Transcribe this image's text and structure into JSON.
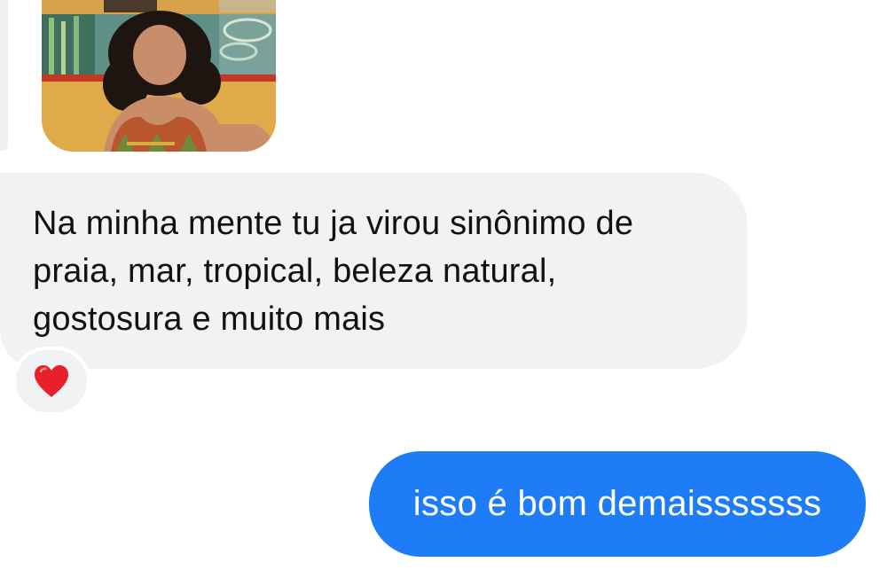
{
  "messages": {
    "incoming_photo": {
      "kind": "photo"
    },
    "incoming_text": "Na minha mente tu ja virou sinônimo de praia, mar, tropical, beleza natural, gostosura e muito mais",
    "reaction": {
      "emoji": "❤️",
      "icon": "heart-icon"
    },
    "outgoing_text": "isso é bom demaisssssss"
  },
  "colors": {
    "incoming_bubble": "#f1f2f4",
    "outgoing_bubble": "#1e7cf6",
    "incoming_text": "#111111",
    "outgoing_text": "#ffffff",
    "heart": "#e8202a"
  }
}
